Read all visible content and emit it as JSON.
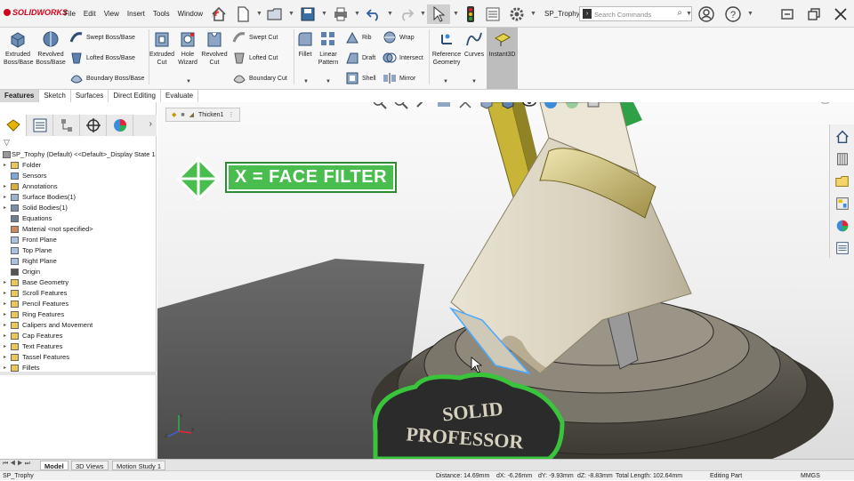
{
  "app": {
    "logo_text": "SOLIDWORKS",
    "brand_color": "#d0021b"
  },
  "menu": [
    "File",
    "Edit",
    "View",
    "Insert",
    "Tools",
    "Window"
  ],
  "document": {
    "name": "SP_Trophy"
  },
  "search": {
    "placeholder": "Search Commands"
  },
  "command_manager": {
    "extruded_boss": "Extruded Boss/Base",
    "revolved_boss": "Revolved Boss/Base",
    "swept_boss": "Swept Boss/Base",
    "lofted_boss": "Lofted Boss/Base",
    "boundary_boss": "Boundary Boss/Base",
    "extruded_cut": "Extruded Cut",
    "hole_wizard": "Hole Wizard",
    "revolved_cut": "Revolved Cut",
    "swept_cut": "Swept Cut",
    "lofted_cut": "Lofted Cut",
    "boundary_cut": "Boundary Cut",
    "fillet": "Fillet",
    "linear_pattern": "Linear Pattern",
    "rib": "Rib",
    "draft": "Draft",
    "shell": "Shell",
    "wrap": "Wrap",
    "intersect": "Intersect",
    "mirror": "Mirror",
    "reference_geometry": "Reference Geometry",
    "curves": "Curves",
    "instant3d": "Instant3D"
  },
  "cm_tabs": [
    "Features",
    "Sketch",
    "Surfaces",
    "Direct Editing",
    "Evaluate"
  ],
  "tree": {
    "root": "SP_Trophy (Default) <<Default>_Display State 1",
    "items": [
      {
        "label": "Folder",
        "icon": "folder",
        "expand": true
      },
      {
        "label": "Sensors",
        "icon": "sensor",
        "expand": false
      },
      {
        "label": "Annotations",
        "icon": "annotation",
        "expand": true
      },
      {
        "label": "Surface Bodies(1)",
        "icon": "surface",
        "expand": true
      },
      {
        "label": "Solid Bodies(1)",
        "icon": "solid",
        "expand": true
      },
      {
        "label": "Equations",
        "icon": "equation",
        "expand": false
      },
      {
        "label": "Material <not specified>",
        "icon": "material",
        "expand": false
      },
      {
        "label": "Front Plane",
        "icon": "plane",
        "expand": false
      },
      {
        "label": "Top Plane",
        "icon": "plane",
        "expand": false
      },
      {
        "label": "Right Plane",
        "icon": "plane",
        "expand": false
      },
      {
        "label": "Origin",
        "icon": "origin",
        "expand": false
      },
      {
        "label": "Base Geometry",
        "icon": "folder",
        "expand": true
      },
      {
        "label": "Scroll Features",
        "icon": "folder",
        "expand": true
      },
      {
        "label": "Pencil Features",
        "icon": "folder",
        "expand": true
      },
      {
        "label": "Ring Features",
        "icon": "folder",
        "expand": true
      },
      {
        "label": "Calipers and Movement",
        "icon": "folder",
        "expand": true
      },
      {
        "label": "Cap Features",
        "icon": "folder",
        "expand": true
      },
      {
        "label": "Text Features",
        "icon": "folder",
        "expand": true
      },
      {
        "label": "Tassel Features",
        "icon": "folder",
        "expand": true
      },
      {
        "label": "Fillets",
        "icon": "folder",
        "expand": true
      }
    ]
  },
  "viewport": {
    "breadcrumb": "Thicken1",
    "overlay_label": "X = FACE FILTER",
    "overlay_color": "#49bd4d",
    "plaque_line1": "SOLID",
    "plaque_line2": "PROFESSOR"
  },
  "bottom_tabs": [
    "Model",
    "3D Views",
    "Motion Study 1"
  ],
  "status": {
    "doc": "SP_Trophy",
    "distance": "Distance: 14.69mm",
    "dx": "dX: -6.26mm",
    "dy": "dY: -9.93mm",
    "dz": "dZ: -8.83mm",
    "total": "Total Length: 102.64mm",
    "mode": "Editing Part",
    "units": "MMGS"
  }
}
